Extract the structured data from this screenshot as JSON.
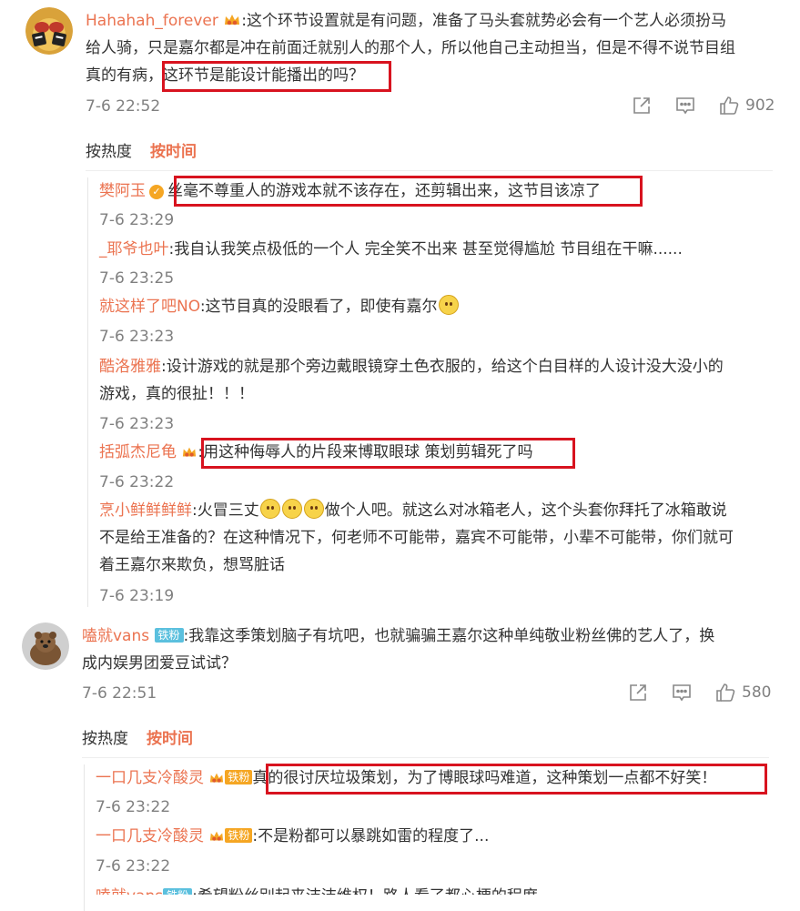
{
  "threads": [
    {
      "user": "Hahahah_forever",
      "text_line1": ":这个环节设置就是有问题，准备了马头套就势必会有一个艺人必须扮马",
      "text_line2": "给人骑，只是嘉尔都是冲在前面迁就别人的那个人，所以他自己主动担当，但是不得不说节目组",
      "text_line3a": "真的有病，",
      "text_line3b": "这环节是能设计能播出的吗？",
      "time": "7-6 22:52",
      "likes": "902",
      "sort": {
        "hot": "按热度",
        "time": "按时间"
      },
      "replies": [
        {
          "user": "樊阿玉",
          "text": "丝毫不尊重人的游戏本就不该存在，还剪辑出来，这节目该凉了",
          "time": "7-6 23:29"
        },
        {
          "user": "_耶爷也叶",
          "text": ":我自认我笑点极低的一个人 完全笑不出来 甚至觉得尴尬 节目组在干嘛......",
          "time": "7-6 23:25"
        },
        {
          "user": "就这样了吧NO",
          "text": ":这节目真的没眼看了，即使有嘉尔",
          "time": "7-6 23:23"
        },
        {
          "user": "酷洛雅雅",
          "text": ":设计游戏的就是那个旁边戴眼镜穿土色衣服的，给这个白目样的人设计没大没小的",
          "text2": "游戏，真的很扯！！！",
          "time": "7-6 23:23"
        },
        {
          "user": "括弧杰尼龟",
          "text": ":用这种侮辱人的片段来博取眼球 策划剪辑死了吗",
          "time": "7-6 23:22"
        },
        {
          "user": "烹小鲜鲜鲜鲜",
          "text": ":火冒三丈",
          "text_b": "做个人吧。就这么对冰箱老人，这个头套你拜托了冰箱敢说",
          "text2": "不是给王准备的？在这种情况下，何老师不可能带，嘉宾不可能带，小辈不可能带，你们就可",
          "text3": "着王嘉尔来欺负，想骂脏话",
          "time": "7-6 23:19"
        }
      ]
    },
    {
      "user": "嗑就vans",
      "badge": "铁粉",
      "text_line1": ":我靠这季策划脑子有坑吧，也就骗骗王嘉尔这种单纯敬业粉丝佛的艺人了，换",
      "text_line2": "成内娱男团爱豆试试？",
      "time": "7-6 22:51",
      "likes": "580",
      "sort": {
        "hot": "按热度",
        "time": "按时间"
      },
      "replies": [
        {
          "user": "一口几支冷酸灵",
          "badge": "铁粉",
          "text": "真的很讨厌垃圾策划，为了博眼球吗难道，这种策划一点都不好笑！",
          "time": "7-6 23:22"
        },
        {
          "user": "一口几支冷酸灵",
          "badge": "铁粉",
          "text": ":不是粉都可以暴跳如雷的程度了...",
          "time": "7-6 23:22"
        },
        {
          "user": "嗑就vans",
          "badge": "铁粉",
          "text": ":希望粉丝别起来洁洁维权！路人看了都心梗的程度"
        }
      ]
    }
  ]
}
